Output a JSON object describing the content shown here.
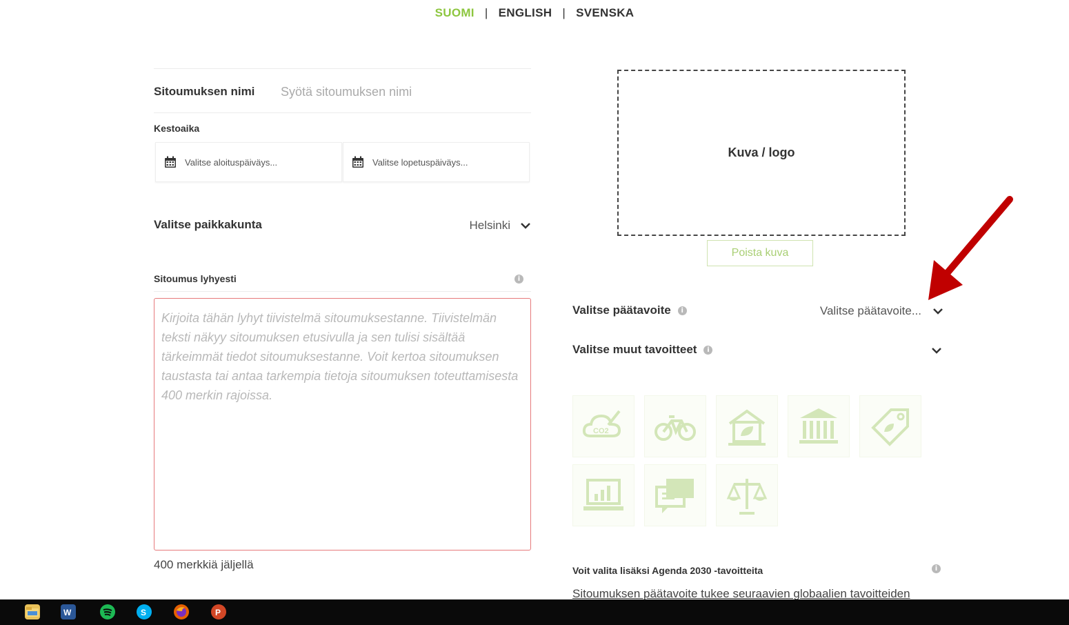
{
  "language_bar": {
    "active": "SUOMI",
    "english": "ENGLISH",
    "swedish": "SVENSKA",
    "separator": "|"
  },
  "form": {
    "name_label": "Sitoumuksen nimi",
    "name_placeholder": "Syötä sitoumuksen nimi",
    "duration_label": "Kestoaika",
    "start_date_placeholder": "Valitse aloituspäiväys...",
    "end_date_placeholder": "Valitse lopetuspäiväys...",
    "city_label": "Valitse paikkakunta",
    "city_value": "Helsinki",
    "summary_label": "Sitoumus lyhyesti",
    "summary_placeholder": "Kirjoita tähän lyhyt tiivistelmä sitoumuksestanne. Tiivistelmän teksti näkyy sitoumuksen etusivulla ja sen tulisi sisältää tärkeimmät tiedot sitoumuksestanne. Voit kertoa sitoumuksen taustasta tai antaa tarkempia tietoja sitoumuksen toteuttamisesta 400 merkin rajoissa.",
    "chars_left": "400 merkkiä jäljellä"
  },
  "image": {
    "box_label": "Kuva / logo",
    "remove_button": "Poista kuva"
  },
  "goals": {
    "main_goal_label": "Valitse päätavoite",
    "main_goal_value": "Valitse päätavoite...",
    "other_goals_label": "Valitse muut tavoitteet",
    "tiles": [
      "cloud-co2-icon",
      "bicycle-icon",
      "green-house-icon",
      "government-building-icon",
      "eco-tag-icon",
      "laptop-chart-icon",
      "chat-bubbles-icon",
      "scales-icon"
    ]
  },
  "agenda": {
    "title": "Voit valita lisäksi Agenda 2030 -tavoitteita",
    "text": "Sitoumuksen päätavoite tukee seuraavien globaalien tavoitteiden"
  },
  "colors": {
    "accent": "#8dc63f",
    "error_border": "#e6797b",
    "arrow": "#c00000",
    "taskbar": "#0a0a0a"
  },
  "taskbar": {
    "icons": [
      "file-explorer-icon",
      "word-icon",
      "spotify-icon",
      "skype-icon",
      "firefox-icon",
      "powerpoint-icon"
    ]
  }
}
